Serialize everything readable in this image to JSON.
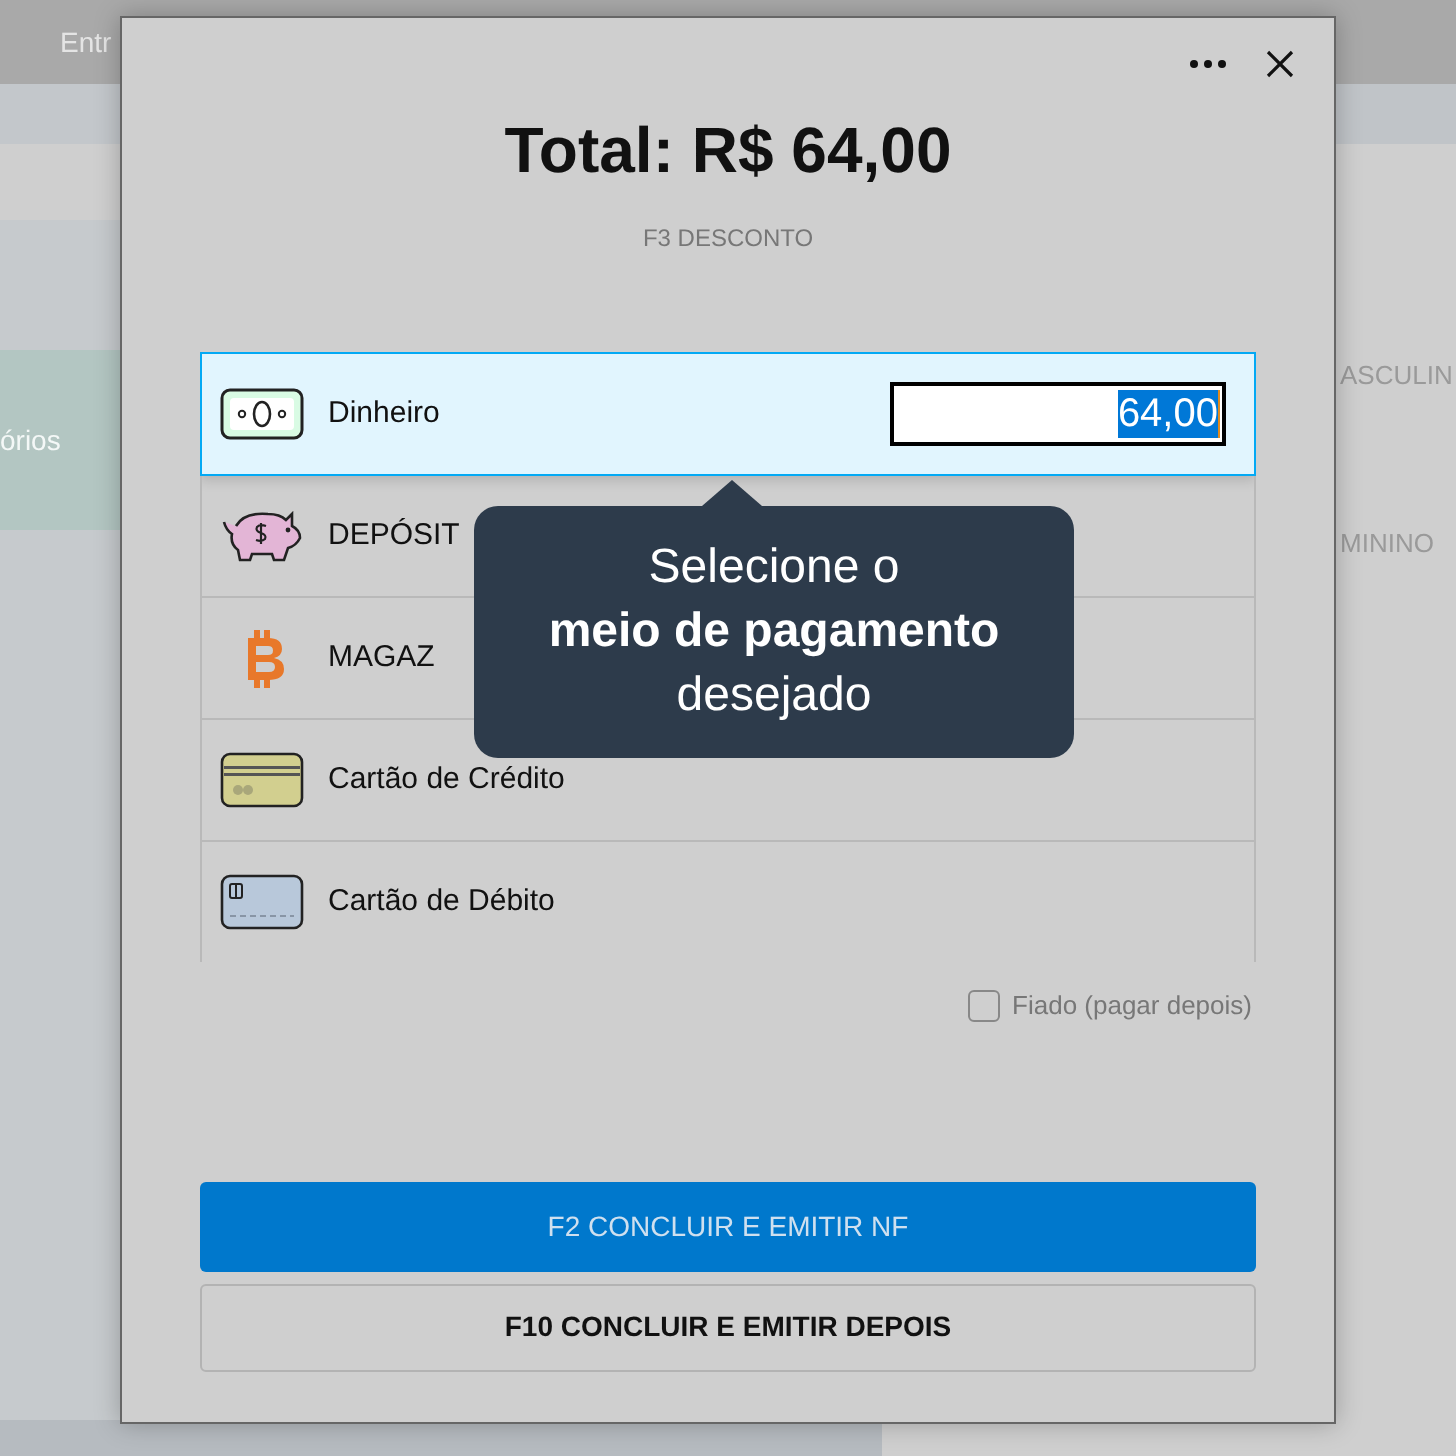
{
  "background": {
    "topbar_text": "Entr",
    "sidebar_text": "órios",
    "right_texts": [
      "ASCULIN",
      "MININO"
    ]
  },
  "dialog": {
    "title": "Total: R$ 64,00",
    "discount_link": "F3 DESCONTO",
    "payment_methods": [
      {
        "label": "Dinheiro",
        "selected": true,
        "amount": "64,00"
      },
      {
        "label": "DEPÓSIT",
        "selected": false
      },
      {
        "label": "MAGAZ",
        "selected": false
      },
      {
        "label": "Cartão de Crédito",
        "selected": false
      },
      {
        "label": "Cartão de Débito",
        "selected": false
      }
    ],
    "tooltip": "Selecione o\n**meio de pagamento**\ndesejado",
    "credit_option": {
      "label": "Fiado (pagar depois)",
      "checked": false
    },
    "buttons": [
      {
        "label": "F2 CONCLUIR E EMITIR NF",
        "kind": "primary"
      },
      {
        "label": "F10 CONCLUIR E EMITIR DEPOIS",
        "kind": "secondary"
      }
    ]
  }
}
